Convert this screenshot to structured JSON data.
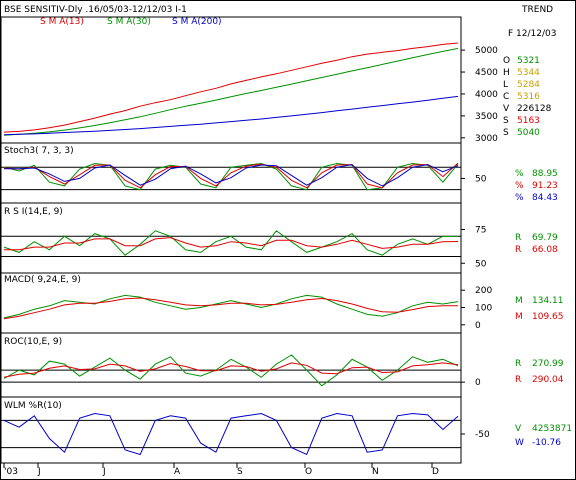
{
  "header": {
    "title": "BSE SENSITIV-Dly .16/05/03-12/12/03  I-1",
    "trend_label": "TREND",
    "sma_labels": [
      {
        "text": "S M A(13)",
        "color": "#e00000"
      },
      {
        "text": "S M A(30)",
        "color": "#009000"
      },
      {
        "text": "S M A(200)",
        "color": "#0000cc"
      }
    ]
  },
  "info": {
    "date": "F 12/12/03",
    "rows": [
      {
        "k": "O",
        "v": "5321",
        "color": "#009000"
      },
      {
        "k": "H",
        "v": "5344",
        "color": "#c8a000"
      },
      {
        "k": "L",
        "v": "5284",
        "color": "#c8a000"
      },
      {
        "k": "C",
        "v": "5316",
        "color": "#c8a000"
      },
      {
        "k": "V",
        "v": "226128",
        "color": "#000000"
      },
      {
        "k": "S",
        "v": "5163",
        "color": "#e00000"
      },
      {
        "k": "S",
        "v": "5040",
        "color": "#009000"
      }
    ]
  },
  "colors": {
    "k": "#009000",
    "d": "#e00000",
    "sd": "#0000cc",
    "price": "#000000",
    "grid": "#000000"
  },
  "chart_data": {
    "type": "line",
    "x_ticks": [
      "'03",
      "J",
      "J",
      "A",
      "S",
      "O",
      "N",
      "D"
    ],
    "panels": [
      {
        "id": "price",
        "y_ticks": [
          3000,
          3500,
          4000,
          4500,
          5000
        ],
        "ylim": [
          2950,
          5550
        ],
        "series": [
          {
            "name": "S M A(13)",
            "color": "#e00000",
            "values": [
              3130,
              3145,
              3180,
              3230,
              3290,
              3370,
              3450,
              3540,
              3620,
              3720,
              3800,
              3870,
              3960,
              4050,
              4130,
              4230,
              4310,
              4390,
              4460,
              4540,
              4620,
              4700,
              4770,
              4850,
              4910,
              4950,
              4990,
              5040,
              5080,
              5130,
              5163
            ]
          },
          {
            "name": "S M A(30)",
            "color": "#009000",
            "values": [
              3060,
              3080,
              3105,
              3135,
              3175,
              3225,
              3280,
              3345,
              3410,
              3480,
              3560,
              3640,
              3720,
              3790,
              3860,
              3935,
              4010,
              4080,
              4155,
              4225,
              4300,
              4375,
              4450,
              4525,
              4600,
              4675,
              4750,
              4825,
              4900,
              4970,
              5040
            ]
          },
          {
            "name": "S M A(200)",
            "color": "#0000cc",
            "values": [
              3070,
              3080,
              3090,
              3105,
              3120,
              3135,
              3150,
              3170,
              3190,
              3210,
              3235,
              3260,
              3285,
              3310,
              3340,
              3370,
              3400,
              3430,
              3465,
              3500,
              3535,
              3575,
              3615,
              3655,
              3695,
              3735,
              3775,
              3815,
              3855,
              3900,
              3945
            ]
          }
        ]
      },
      {
        "id": "stoch",
        "title": "Stoch3( 7, 3, 3)",
        "y_ticks": [
          50
        ],
        "ylim": [
          -5,
          110
        ],
        "levels": [
          80,
          20
        ],
        "series": [
          {
            "name": "%K",
            "color": "#009000",
            "values": [
              80,
              70,
              85,
              40,
              30,
              75,
              90,
              85,
              30,
              20,
              75,
              85,
              80,
              35,
              25,
              80,
              85,
              90,
              75,
              30,
              20,
              80,
              90,
              85,
              20,
              25,
              80,
              90,
              85,
              40,
              89
            ]
          },
          {
            "name": "%D",
            "color": "#e00000",
            "values": [
              78,
              75,
              80,
              55,
              35,
              60,
              85,
              86,
              45,
              25,
              60,
              82,
              82,
              50,
              30,
              65,
              83,
              88,
              80,
              45,
              25,
              65,
              86,
              87,
              35,
              25,
              65,
              86,
              87,
              55,
              91
            ]
          },
          {
            "name": "%SD",
            "color": "#0000cc",
            "values": [
              76,
              76,
              78,
              62,
              42,
              50,
              78,
              86,
              58,
              32,
              48,
              76,
              83,
              62,
              38,
              52,
              78,
              86,
              84,
              58,
              32,
              52,
              80,
              87,
              50,
              30,
              52,
              80,
              87,
              68,
              84
            ]
          }
        ],
        "readout": [
          {
            "k": "%",
            "v": "88.95",
            "color": "#009000"
          },
          {
            "k": "%",
            "v": "91.23",
            "color": "#e00000"
          },
          {
            "k": "%",
            "v": "84.43",
            "color": "#0000cc"
          }
        ]
      },
      {
        "id": "rsi",
        "title": "R S I(14,E, 9)",
        "y_ticks": [
          75,
          50
        ],
        "ylim": [
          45,
          85
        ],
        "levels": [
          70,
          55
        ],
        "series": [
          {
            "name": "R",
            "color": "#009000",
            "values": [
              62,
              58,
              66,
              60,
              70,
              63,
              72,
              68,
              56,
              64,
              74,
              70,
              60,
              58,
              66,
              70,
              62,
              60,
              74,
              66,
              58,
              62,
              66,
              72,
              60,
              56,
              64,
              68,
              64,
              70,
              69.79
            ]
          },
          {
            "name": "R",
            "color": "#e00000",
            "values": [
              60,
              60,
              62,
              62,
              65,
              65,
              68,
              68,
              63,
              63,
              68,
              69,
              65,
              62,
              63,
              66,
              65,
              63,
              67,
              67,
              63,
              62,
              64,
              67,
              64,
              61,
              62,
              64,
              64,
              66,
              66.08
            ]
          }
        ],
        "readout": [
          {
            "k": "R",
            "v": "69.79",
            "color": "#009000"
          },
          {
            "k": "R",
            "v": "66.08",
            "color": "#e00000"
          }
        ]
      },
      {
        "id": "macd",
        "title": "MACD( 9,24,E, 9)",
        "y_ticks": [
          200,
          100,
          0
        ],
        "ylim": [
          -30,
          230
        ],
        "series": [
          {
            "name": "M",
            "color": "#009000",
            "values": [
              40,
              60,
              90,
              110,
              140,
              130,
              120,
              150,
              170,
              160,
              130,
              110,
              90,
              100,
              120,
              140,
              120,
              100,
              120,
              150,
              170,
              160,
              120,
              90,
              60,
              50,
              70,
              110,
              130,
              120,
              134.11
            ]
          },
          {
            "name": "M",
            "color": "#e00000",
            "values": [
              35,
              50,
              70,
              90,
              115,
              125,
              125,
              135,
              150,
              155,
              145,
              130,
              115,
              110,
              115,
              125,
              125,
              115,
              118,
              130,
              145,
              152,
              140,
              120,
              95,
              75,
              72,
              88,
              105,
              110,
              109.65
            ]
          }
        ],
        "readout": [
          {
            "k": "M",
            "v": "134.11",
            "color": "#009000"
          },
          {
            "k": "M",
            "v": "109.65",
            "color": "#e00000"
          }
        ]
      },
      {
        "id": "roc",
        "title": "ROC(10,E, 9)",
        "y_ticks": [
          0
        ],
        "ylim": [
          -180,
          600
        ],
        "levels": [
          0,
          200
        ],
        "series": [
          {
            "name": "R",
            "color": "#009000",
            "values": [
              60,
              200,
              120,
              350,
              300,
              100,
              250,
              400,
              200,
              50,
              300,
              420,
              150,
              100,
              200,
              380,
              250,
              80,
              300,
              450,
              200,
              -60,
              120,
              380,
              250,
              30,
              200,
              420,
              330,
              380,
              270.99
            ]
          },
          {
            "name": "R",
            "color": "#e00000",
            "values": [
              80,
              130,
              150,
              230,
              270,
              210,
              220,
              300,
              270,
              180,
              220,
              310,
              260,
              190,
              190,
              270,
              260,
              180,
              220,
              320,
              280,
              150,
              140,
              240,
              250,
              160,
              170,
              270,
              290,
              320,
              290.04
            ]
          }
        ],
        "readout": [
          {
            "k": "R",
            "v": "270.99",
            "color": "#009000"
          },
          {
            "k": "R",
            "v": "290.04",
            "color": "#e00000"
          }
        ]
      },
      {
        "id": "wlm",
        "title": "WLM %R(10)",
        "y_ticks": [
          -50
        ],
        "ylim": [
          -105,
          5
        ],
        "levels": [
          -20,
          -80
        ],
        "series": [
          {
            "name": "W",
            "color": "#0000cc",
            "values": [
              -20,
              -35,
              -10,
              -60,
              -90,
              -15,
              -5,
              -10,
              -85,
              -95,
              -20,
              -10,
              -15,
              -70,
              -90,
              -15,
              -10,
              -5,
              -20,
              -80,
              -95,
              -15,
              -5,
              -10,
              -90,
              -85,
              -10,
              -5,
              -8,
              -40,
              -10.76
            ]
          }
        ],
        "readout": [
          {
            "k": "V",
            "v": "4253871",
            "color": "#009000"
          },
          {
            "k": "W",
            "v": "-10.76",
            "color": "#0000cc"
          }
        ]
      }
    ]
  }
}
